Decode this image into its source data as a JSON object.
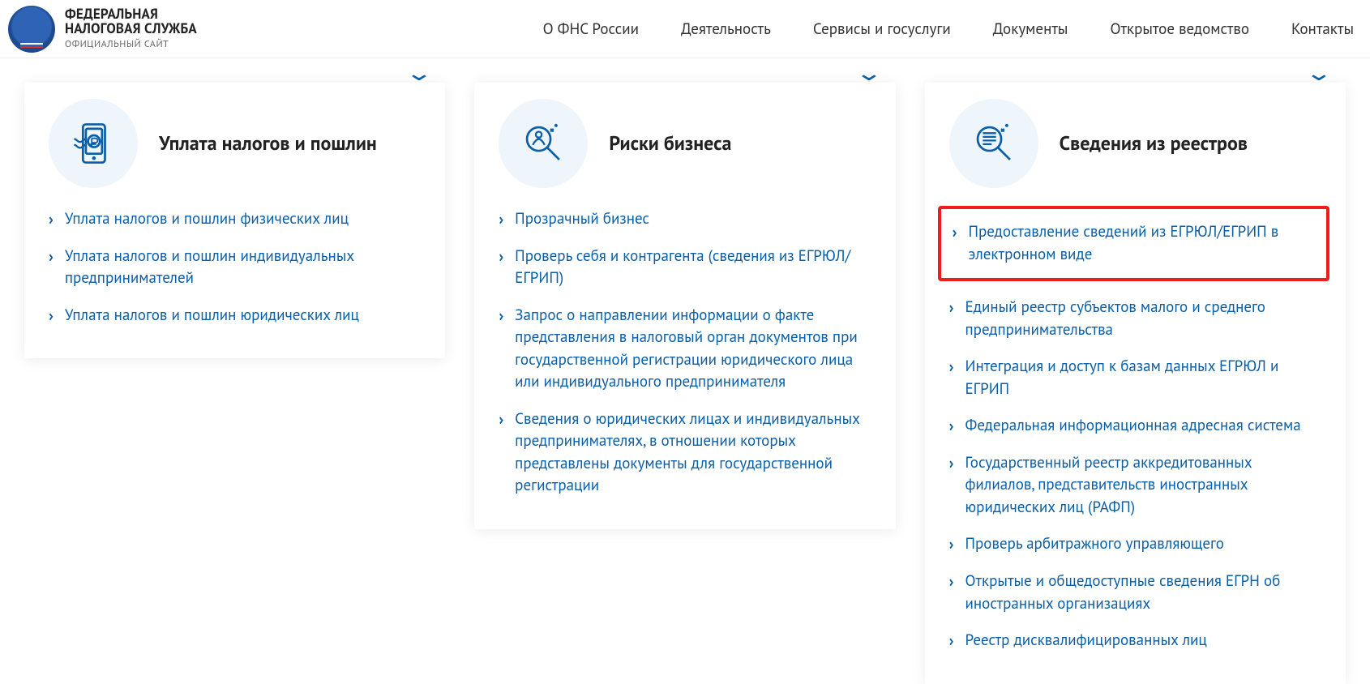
{
  "header": {
    "logo_line1": "ФЕДЕРАЛЬНАЯ",
    "logo_line2": "НАЛОГОВАЯ СЛУЖБА",
    "logo_sub": "ОФИЦИАЛЬНЫЙ САЙТ",
    "nav": [
      "О ФНС России",
      "Деятельность",
      "Сервисы и госуслуги",
      "Документы",
      "Открытое ведомство",
      "Контакты"
    ]
  },
  "cards": [
    {
      "title": "Уплата налогов и пошлин",
      "icon": "payment",
      "links": [
        "Уплата налогов и пошлин физических лиц",
        "Уплата налогов и пошлин индивидуальных предпринимателей",
        "Уплата налогов и пошлин юридических лиц"
      ]
    },
    {
      "title": "Риски бизнеса",
      "icon": "risk",
      "links": [
        "Прозрачный бизнес",
        "Проверь себя и контрагента (сведения из ЕГРЮЛ/ЕГРИП)",
        "Запрос о направлении информации о факте представления в налоговый орган документов при государственной регистрации юридического лица или индивидуального предпринимателя",
        "Сведения о юридических лицах и индивидуальных предпринимателях, в отношении которых представлены документы для государственной регистрации"
      ]
    },
    {
      "title": "Сведения из реестров",
      "icon": "registry",
      "highlighted_index": 0,
      "links": [
        "Предоставление сведений из ЕГРЮЛ/ЕГРИП в электронном виде",
        "Единый реестр субъектов малого и среднего предпринимательства",
        "Интеграция и доступ к базам данных ЕГРЮЛ и ЕГРИП",
        "Федеральная информационная адресная система",
        "Государственный реестр аккредитованных филиалов, представительств иностранных юридических лиц (РАФП)",
        "Проверь арбитражного управляющего",
        "Открытые и общедоступные сведения ЕГРН об иностранных организациях",
        "Реестр дисквалифицированных лиц"
      ]
    }
  ],
  "colors": {
    "primary": "#0a5fa8",
    "highlight": "#ee1c1c"
  }
}
